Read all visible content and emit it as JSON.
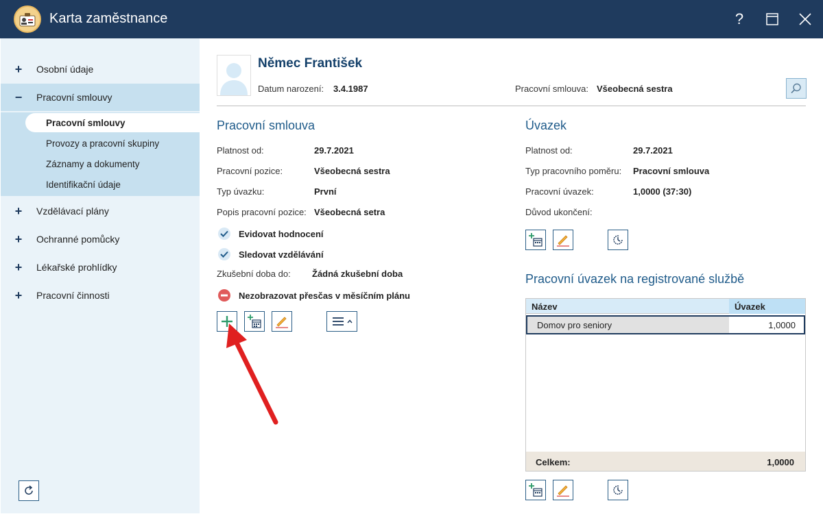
{
  "window": {
    "title": "Karta zaměstnance",
    "help_label": "?"
  },
  "sidebar": {
    "items": [
      {
        "sign": "+",
        "label": "Osobní údaje"
      },
      {
        "sign": "−",
        "label": "Pracovní smlouvy"
      },
      {
        "sign": "+",
        "label": "Vzdělávací plány"
      },
      {
        "sign": "+",
        "label": "Ochranné pomůcky"
      },
      {
        "sign": "+",
        "label": "Lékařské prohlídky"
      },
      {
        "sign": "+",
        "label": "Pracovní činnosti"
      }
    ],
    "subitems": [
      {
        "label": "Pracovní smlouvy",
        "active": true
      },
      {
        "label": "Provozy a pracovní skupiny"
      },
      {
        "label": "Záznamy a dokumenty"
      },
      {
        "label": "Identifikační údaje"
      }
    ]
  },
  "header": {
    "name": "Němec František",
    "dob_label": "Datum narození:",
    "dob_value": "3.4.1987",
    "contract_label": "Pracovní smlouva:",
    "contract_value": "Všeobecná sestra"
  },
  "contract": {
    "title": "Pracovní smlouva",
    "fields": [
      {
        "label": "Platnost od:",
        "value": "29.7.2021"
      },
      {
        "label": "Pracovní pozice:",
        "value": "Všeobecná sestra"
      },
      {
        "label": "Typ úvazku:",
        "value": "První"
      },
      {
        "label": "Popis pracovní pozice:",
        "value": "Všeobecná setra"
      }
    ],
    "checks": [
      "Evidovat hodnocení",
      "Sledovat vzdělávání"
    ],
    "probation_label": "Zkušební doba do:",
    "probation_value": "Žádná zkušební doba",
    "overtime_label": "Nezobrazovat přesčas v měsíčním plánu"
  },
  "workload": {
    "title": "Úvazek",
    "fields": [
      {
        "label": "Platnost od:",
        "value": "29.7.2021"
      },
      {
        "label": "Typ pracovního poměru:",
        "value": "Pracovní smlouva"
      },
      {
        "label": "Pracovní úvazek:",
        "value": "1,0000 (37:30)"
      },
      {
        "label": "Důvod ukončení:",
        "value": ""
      }
    ]
  },
  "service": {
    "title": "Pracovní úvazek na registrované službě",
    "columns": [
      "Název",
      "Úvazek"
    ],
    "rows": [
      {
        "name": "Domov pro seniory",
        "value": "1,0000"
      }
    ],
    "total_label": "Celkem:",
    "total_value": "1,0000"
  },
  "colors": {
    "titlebar": "#1f3b5e",
    "sidebar": "#eaf3f9",
    "sidebar_selected": "#c6e0ef",
    "accent": "#1f5b8a",
    "add_green": "#2e9b6a",
    "arrow_red": "#e02020"
  }
}
